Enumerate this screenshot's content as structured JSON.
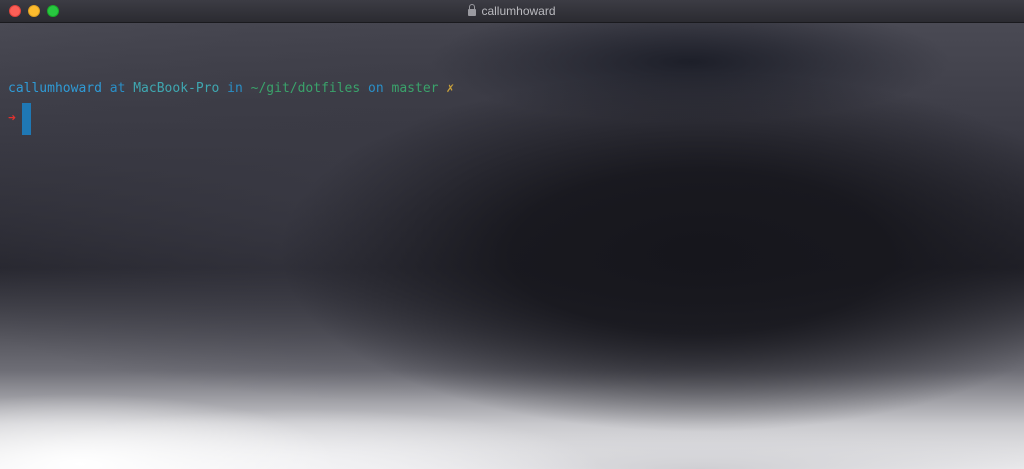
{
  "window": {
    "title": "callumhoward",
    "title_icon": "lock-icon",
    "buttons": {
      "close_color": "#fd5f57",
      "minimize_color": "#fdbc2e",
      "maximize_color": "#28c840"
    }
  },
  "terminal": {
    "prompt": {
      "user": "callumhoward",
      "at": " at ",
      "host": "MacBook-Pro",
      "in": " in ",
      "path": "~/git/dotfiles",
      "on": " on ",
      "branch": "master",
      "git_status": " ✗"
    },
    "prompt_symbol": "➜",
    "colors": {
      "prompt_blue": "#2f9bd6",
      "symbol_red": "#e0322f",
      "cursor": "#1f78b4"
    }
  }
}
